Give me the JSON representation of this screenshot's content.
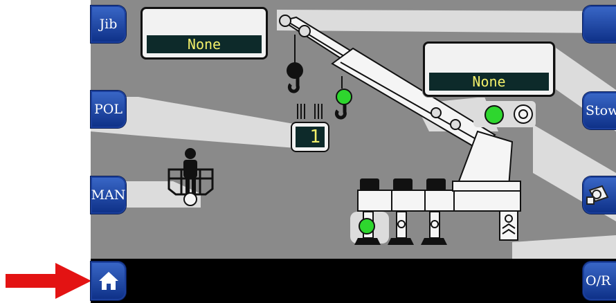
{
  "left_buttons": {
    "jib": "Jib",
    "pol": "POL",
    "man": "MAN"
  },
  "right_buttons": {
    "stow": "Stow",
    "or": "O/R"
  },
  "panels": {
    "hook_load_left": "None",
    "hook_load_right": "None"
  },
  "falls_counter": "1",
  "icons": {
    "home": "home-icon",
    "pointer": "red-arrow-icon",
    "hook": "crane-hook-icon",
    "person": "personnel-basket-icon",
    "camera": "camera-icon"
  },
  "colors": {
    "screen_bg": "#8a8a8a",
    "button": "#1b3f9c",
    "indicator_green": "#2ed62e",
    "display_text": "#f3f06a",
    "arrow": "#e01010"
  }
}
